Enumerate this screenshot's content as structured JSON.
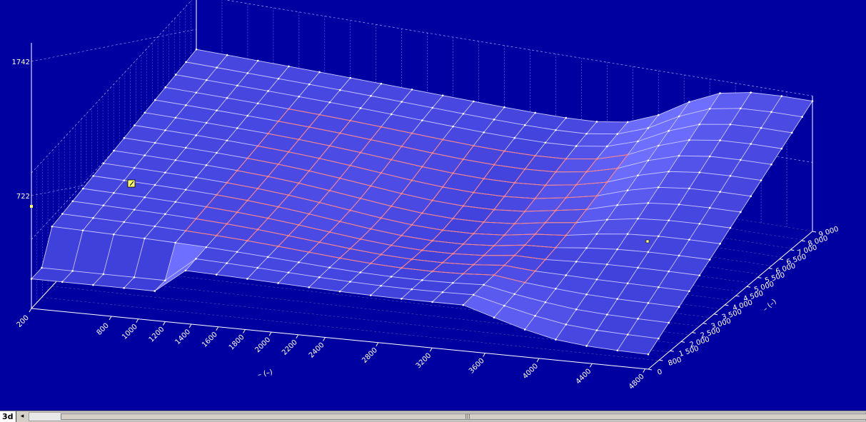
{
  "viewer": {
    "z_ticks": [
      "1742",
      "722"
    ],
    "x_ticks": [
      "200",
      "800",
      "1000",
      "1200",
      "1400",
      "1600",
      "1800",
      "2000",
      "2200",
      "2400",
      "2800",
      "3200",
      "3600",
      "4000",
      "4400",
      "4800"
    ],
    "x_axis_label": "–   (–)",
    "y_ticks": [
      "0",
      "800",
      "1 500",
      "2 000",
      "2 500",
      "3 000",
      "3 500",
      "4 000",
      "4 500",
      "5 000",
      "5 500",
      "6 000",
      "6 500",
      "7 000",
      "8 000",
      "9 000"
    ],
    "y_axis_label": "–   (–)"
  },
  "statusbar": {
    "sheet_tab_label": "3d",
    "nav_left_icon": "triangle-left-icon",
    "scroll_grip": "|||"
  },
  "colors": {
    "background": "#0000a0",
    "surface_fill": "#3030e0",
    "surface_fill_light": "#5a5aff",
    "mesh_line": "#c8c8ff",
    "highlight_line": "#ff8080",
    "marker": "#ffff66"
  }
}
